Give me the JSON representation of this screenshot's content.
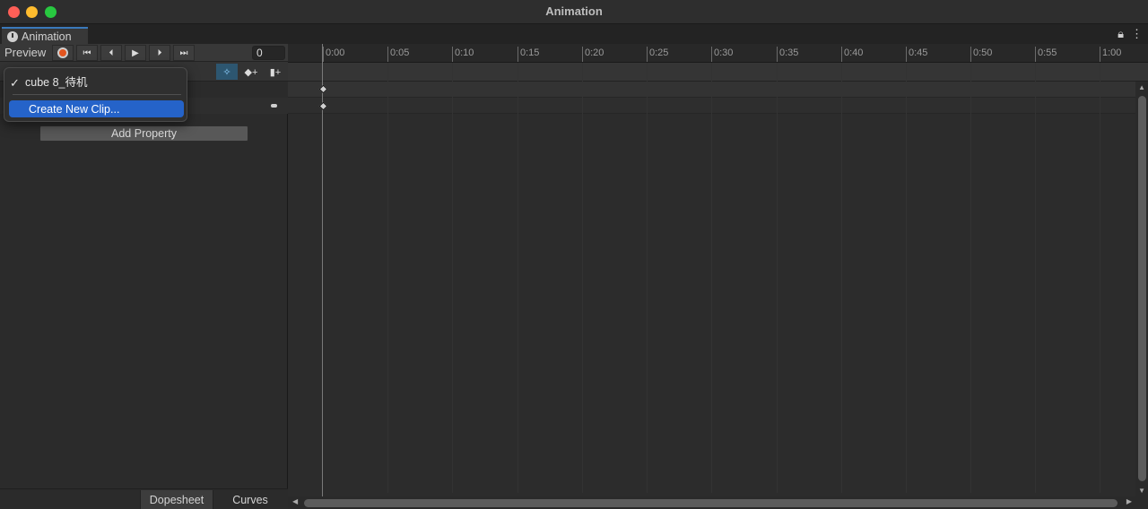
{
  "window": {
    "title": "Animation"
  },
  "tab": {
    "label": "Animation"
  },
  "toolbar": {
    "preview_label": "Preview",
    "frame_value": "0",
    "buttons": [
      "record",
      "first-key",
      "prev-key",
      "play",
      "next-key",
      "last-key"
    ]
  },
  "dropdown": {
    "check": "✓",
    "current_clip": "cube 8_待机",
    "create_new": "Create New Clip..."
  },
  "add_property": "Add Property",
  "bottom_tabs": {
    "dopesheet": "Dopesheet",
    "curves": "Curves"
  },
  "ruler": {
    "ticks": [
      "0:00",
      "0:05",
      "0:10",
      "0:15",
      "0:20",
      "0:25",
      "0:30",
      "0:35",
      "0:40",
      "0:45",
      "0:50",
      "0:55",
      "1:00"
    ]
  },
  "colors": {
    "accent": "#2563c9",
    "record": "#e4551f",
    "tab_highlight": "#3a79bb"
  }
}
